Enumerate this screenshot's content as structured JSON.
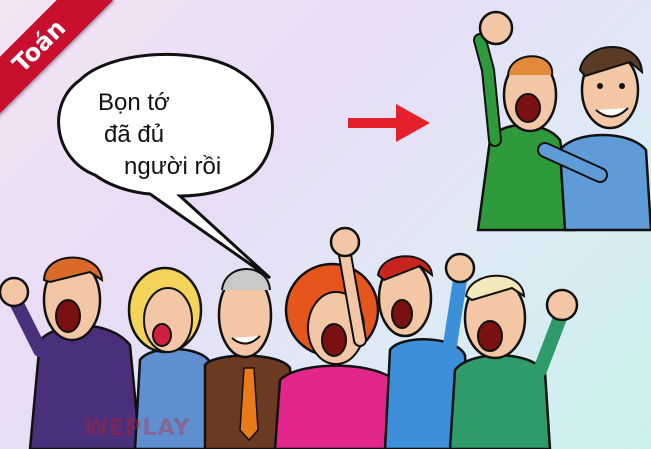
{
  "ribbon_label": "Toán",
  "speech": {
    "line1": "Bọn tớ",
    "line2": "đã đủ",
    "line3": "người rồi"
  },
  "watermark": "WEPLAY",
  "colors": {
    "ribbon": "#c8102e",
    "arrow": "#e5202b",
    "green_shirt": "#2e9a3c",
    "blue_shirt": "#5f9bd6",
    "purple_shirt": "#4a2f7a",
    "pink_shirt": "#e3268a",
    "teal_shirt": "#2f9a6a"
  }
}
